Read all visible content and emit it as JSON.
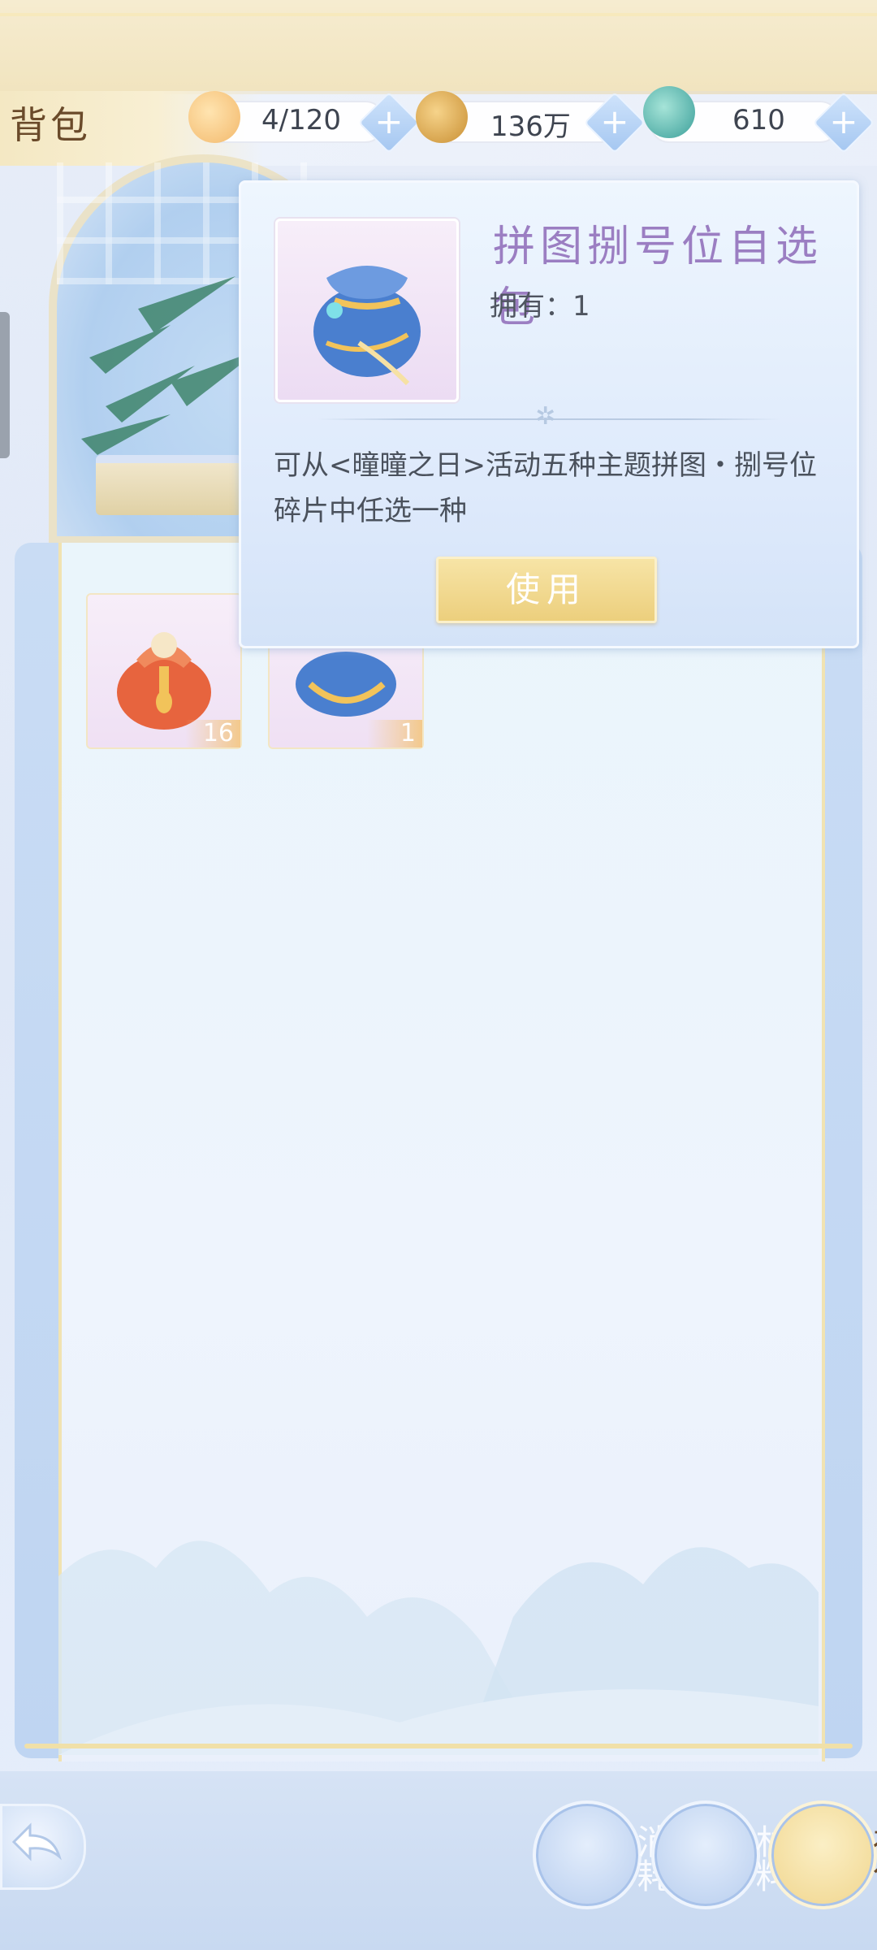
{
  "header": {
    "title": "背包",
    "resources": [
      {
        "icon": "cat-bun-icon",
        "value": "4/120"
      },
      {
        "icon": "gold-coin-icon",
        "value": "136万"
      },
      {
        "icon": "jade-loong-icon",
        "value": "610"
      }
    ],
    "plus_label": "+"
  },
  "inventory": {
    "items": [
      {
        "name": "red-lucky-bag",
        "count": "16"
      },
      {
        "name": "blue-lucky-bag",
        "count": "1"
      }
    ]
  },
  "popup": {
    "title": "拼图捌号位自选包",
    "owned": "拥有：1",
    "description": "可从<曈曈之日>活动五种主题拼图・捌号位碎片中任选一种",
    "use_button": "使用"
  },
  "nav": {
    "tabs": [
      {
        "label": "消耗",
        "active": false
      },
      {
        "label": "材料",
        "active": false
      },
      {
        "label": "礼包",
        "active": true
      }
    ]
  },
  "colors": {
    "accent_gold": "#eccf7d",
    "title_purple": "#9b7ec2",
    "panel_blue": "#c9dcf4"
  }
}
